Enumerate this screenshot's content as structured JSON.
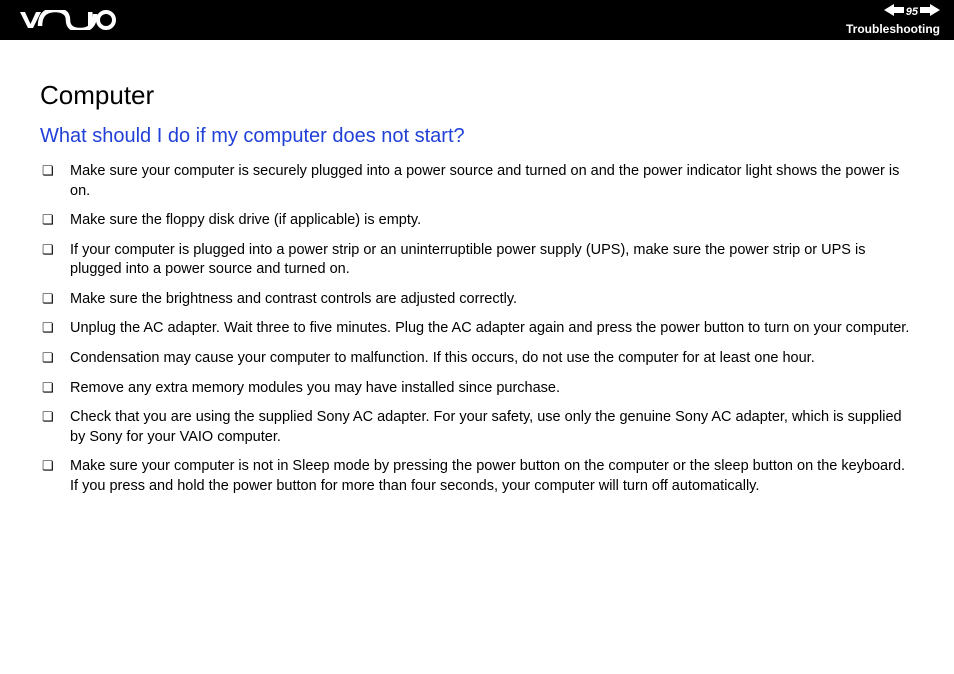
{
  "header": {
    "page_number": "95",
    "section": "Troubleshooting"
  },
  "content": {
    "title": "Computer",
    "question": "What should I do if my computer does not start?",
    "items": [
      "Make sure your computer is securely plugged into a power source and turned on and the power indicator light shows the power is on.",
      "Make sure the floppy disk drive (if applicable) is empty.",
      "If your computer is plugged into a power strip or an uninterruptible power supply (UPS), make sure the power strip or UPS is plugged into a power source and turned on.",
      "Make sure the brightness and contrast controls are adjusted correctly.",
      "Unplug the AC adapter. Wait three to five minutes. Plug the AC adapter again and press the power button to turn on your computer.",
      "Condensation may cause your computer to malfunction. If this occurs, do not use the computer for at least one hour.",
      "Remove any extra memory modules you may have installed since purchase.",
      "Check that you are using the supplied Sony AC adapter. For your safety, use only the genuine Sony AC adapter, which is supplied by Sony for your VAIO computer.",
      "Make sure your computer is not in Sleep mode by pressing the power button on the computer or the sleep button on the keyboard. If you press and hold the power button for more than four seconds, your computer will turn off automatically."
    ]
  }
}
